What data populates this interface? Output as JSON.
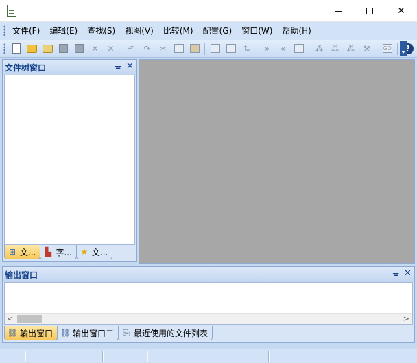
{
  "window": {
    "app_icon": "notepad-icon",
    "controls": {
      "minimize": "minimize-icon",
      "maximize": "maximize-icon",
      "close_glyph": "✕"
    }
  },
  "menu": {
    "items": [
      {
        "label": "文件(F)"
      },
      {
        "label": "编辑(E)"
      },
      {
        "label": "查找(S)"
      },
      {
        "label": "视图(V)"
      },
      {
        "label": "比较(M)"
      },
      {
        "label": "配置(G)"
      },
      {
        "label": "窗口(W)"
      },
      {
        "label": "帮助(H)"
      }
    ]
  },
  "toolbar": {
    "icons": [
      "new-file-icon",
      "open-folder-icon",
      "open-project-icon",
      "save-icon",
      "save-all-icon",
      "close-icon",
      "close-all-icon",
      "undo-icon",
      "redo-icon",
      "cut-icon",
      "copy-icon",
      "paste-icon",
      "find-icon",
      "replace-icon",
      "sort-icon",
      "next-icon",
      "previous-icon",
      "edit-icon",
      "compare-1-icon",
      "compare-2-icon",
      "compare-3-icon",
      "tools-icon",
      "goto-icon",
      "help-icon"
    ],
    "goto_label": "GO",
    "help_label": "?"
  },
  "tree_pane": {
    "title": "文件树窗口",
    "pin": "ᚚ",
    "close": "✕",
    "tabs": [
      {
        "label": "文...",
        "icon": "file-tree-icon",
        "active": true
      },
      {
        "label": "字...",
        "icon": "chart-icon",
        "active": false
      },
      {
        "label": "文...",
        "icon": "star-icon",
        "active": false
      }
    ]
  },
  "output_pane": {
    "title": "输出窗口",
    "pin": "ᚚ",
    "close": "✕",
    "scroll_left": "<",
    "scroll_right": ">",
    "tabs": [
      {
        "label": "输出窗口",
        "icon": "output-icon",
        "active": true
      },
      {
        "label": "输出窗口二",
        "icon": "output-icon",
        "active": false
      },
      {
        "label": "最近使用的文件列表",
        "icon": "recent-files-icon",
        "active": false
      }
    ]
  },
  "colors": {
    "chrome": "#d3e3f7",
    "pane_title": "#15428b",
    "editor_bg": "#a7a7a7",
    "active_tab": "#f7c85a"
  }
}
